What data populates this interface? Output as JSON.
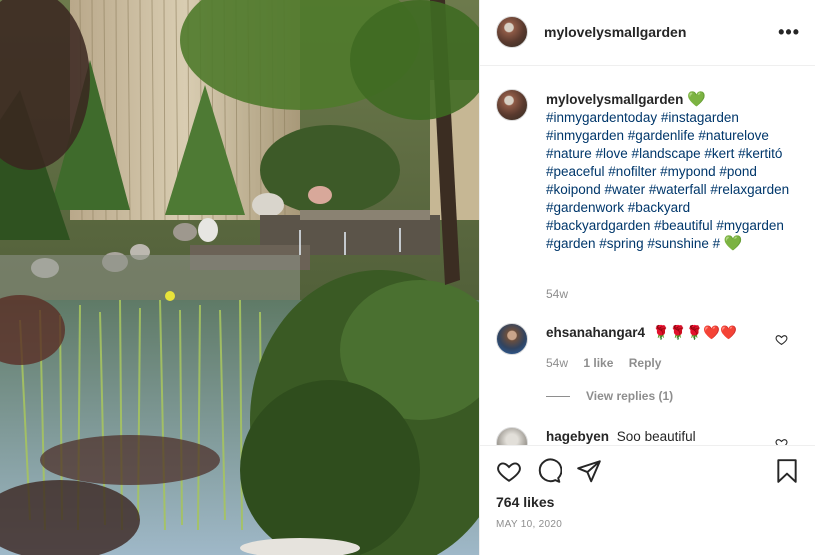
{
  "post": {
    "username": "mylovelysmallgarden",
    "more_glyph": "•••",
    "image_alt": "garden pond with waterfall",
    "avatar_icon": "garden-avatar"
  },
  "caption": {
    "username": "mylovelysmallgarden",
    "heart": "💚",
    "hashtags": "#inmygardentoday #instagarden #inmygarden #gardenlife #naturelove #nature #love #landscape #kert #kertitó #peaceful #nofilter #mypond #pond #koipond #water #waterfall #relaxgarden #gardenwork #backyard #backyardgarden #beautiful #mygarden #garden #spring #sunshine #",
    "heart_end": "💚",
    "time": "54w"
  },
  "comments": [
    {
      "username": "ehsanahangar4",
      "text": "🌹🌹🌹❤️❤️",
      "time": "54w",
      "likes": "1 like",
      "reply": "Reply",
      "view_replies": "View replies (1)"
    },
    {
      "username": "hagebyen",
      "text": "Soo beautiful"
    }
  ],
  "actions": {
    "like_icon": "heart-outline-icon",
    "comment_icon": "comment-icon",
    "share_icon": "paper-plane-icon",
    "save_icon": "bookmark-icon"
  },
  "likes_label": "764 likes",
  "date_label": "MAY 10, 2020",
  "colors": {
    "hashtag": "#00376b",
    "muted": "#8e8e8e",
    "text": "#262626"
  }
}
